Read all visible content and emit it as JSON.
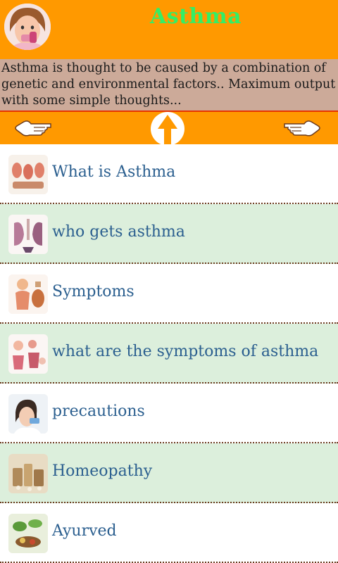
{
  "header": {
    "title": "Asthma",
    "title_color": "#33ee66",
    "bg_color": "#ff9900",
    "avatar_icon": "child-inhaler-photo-icon"
  },
  "description": {
    "text": "Asthma is thought to be caused by a combination of genetic and environmental factors.. Maximum output with some simple thoughts...",
    "bg_color": "#ccaa99"
  },
  "navbar": {
    "left_icon": "pointing-hand-left-icon",
    "center_icon": "up-arrow-icon",
    "right_icon": "pointing-hand-right-icon"
  },
  "list": {
    "items": [
      {
        "label": "What is Asthma",
        "icon": "lungs-diagram-icon"
      },
      {
        "label": "who gets asthma",
        "icon": "lungs-illustration-icon"
      },
      {
        "label": "Symptoms",
        "icon": "respiratory-diagram-icon"
      },
      {
        "label": "what are the symptoms of asthma",
        "icon": "symptoms-diagram-icon"
      },
      {
        "label": "precautions",
        "icon": "woman-inhaler-icon"
      },
      {
        "label": "Homeopathy",
        "icon": "homeopathy-remedies-icon"
      },
      {
        "label": "Ayurved",
        "icon": "ayurveda-herbs-icon"
      }
    ],
    "label_color": "#2b5f8f",
    "alt_row_color": "#dcefdc"
  }
}
